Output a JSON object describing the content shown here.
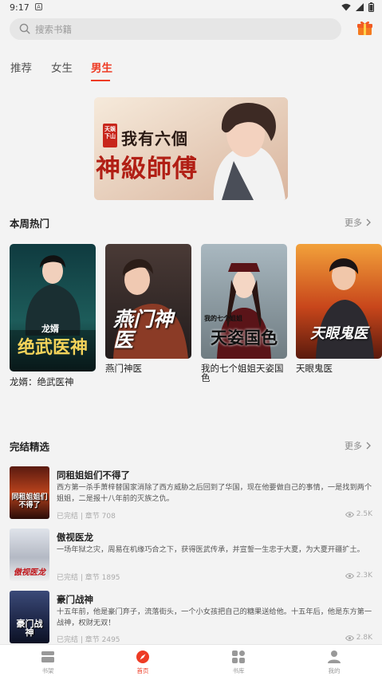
{
  "status": {
    "time": "9:17",
    "a_label": "A"
  },
  "search": {
    "placeholder": "搜索书籍"
  },
  "tabs": [
    {
      "label": "推荐",
      "active": false
    },
    {
      "label": "女生",
      "active": false
    },
    {
      "label": "男生",
      "active": true
    }
  ],
  "banner": {
    "publisher": "天娱下山",
    "title_line1": "我有六個",
    "title_line2": "神級師傅"
  },
  "weekly_hot": {
    "title": "本周热门",
    "more": "更多",
    "books": [
      {
        "title": "龙婿：绝武医神",
        "cover_text": "绝武医神",
        "cover_sub": "龙婿"
      },
      {
        "title": "燕门神医",
        "cover_text": "燕门神医"
      },
      {
        "title": "我的七个姐姐天姿国色",
        "cover_text": "天姿国色",
        "cover_sub": "我的七个姐姐"
      },
      {
        "title": "天眼鬼医",
        "cover_text": "天眼鬼医"
      }
    ]
  },
  "completed": {
    "title": "完结精选",
    "more": "更多",
    "items": [
      {
        "title": "同租姐姐们不得了",
        "desc": "西方第一杀手萧梓替国家消除了西方威胁之后回到了华国，现在他要做自己的事情，一是找到两个姐姐，二是报十八年前的灭族之仇。",
        "meta": "已完结 | 章节 708",
        "views": "2.5K",
        "cover_text": "同租姐姐们不得了"
      },
      {
        "title": "傲视医龙",
        "desc": "一场年狱之灾，周易在机缘巧合之下，获得医武传承，并宣誓一生忠于大夏，为大夏开疆扩土。",
        "meta": "已完结 | 章节 1895",
        "views": "2.3K",
        "cover_text": "傲视医龙"
      },
      {
        "title": "豪门战神",
        "desc": "十五年前，他是豪门弃子，流落街头，一个小女孩把自己的糖果送给他。十五年后，他是东方第一战神，权财无双！",
        "meta": "已完结 | 章节 2495",
        "views": "2.8K",
        "cover_text": "豪门战神"
      }
    ]
  },
  "bottom_nav": [
    {
      "label": "书架",
      "active": false
    },
    {
      "label": "首页",
      "active": true
    },
    {
      "label": "书库",
      "active": false
    },
    {
      "label": "我的",
      "active": false
    }
  ],
  "colors": {
    "accent": "#ee3b24",
    "background": "#f3f3f3"
  }
}
